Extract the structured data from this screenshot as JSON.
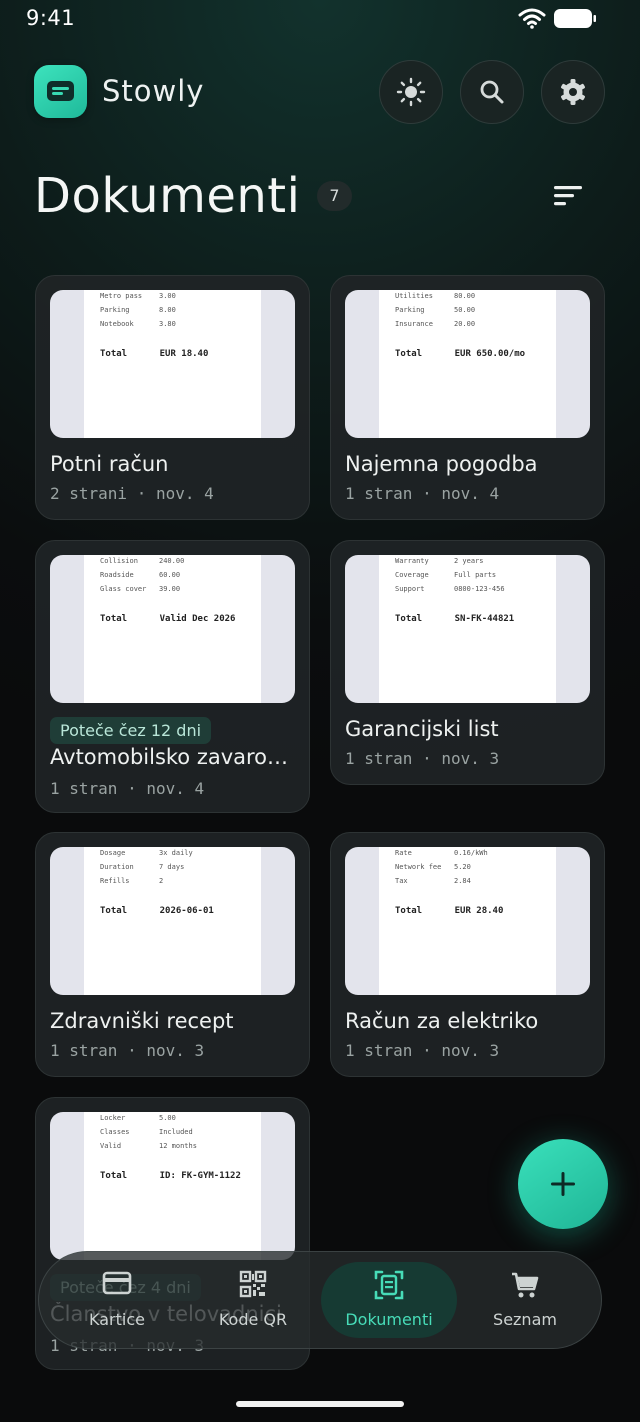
{
  "status": {
    "time": "9:41"
  },
  "app": {
    "title": "Stowly"
  },
  "header": {
    "title": "Dokumenti",
    "count": "7"
  },
  "documents": [
    {
      "title": "Potni račun",
      "meta": "2 strani · nov. 4",
      "expiry": "",
      "receipt": [
        [
          "Metro pass",
          "3.00"
        ],
        [
          "Parking",
          "8.00"
        ],
        [
          "Notebook",
          "3.80"
        ]
      ],
      "total": [
        "Total",
        "EUR 18.40"
      ]
    },
    {
      "title": "Najemna pogodba",
      "meta": "1 stran · nov. 4",
      "expiry": "",
      "receipt": [
        [
          "Utilities",
          "80.00"
        ],
        [
          "Parking",
          "50.00"
        ],
        [
          "Insurance",
          "20.00"
        ]
      ],
      "total": [
        "Total",
        "EUR 650.00/mo"
      ]
    },
    {
      "title": "Avtomobilsko zavarovanje",
      "meta": "1 stran · nov. 4",
      "expiry": "Poteče čez 12 dni",
      "receipt": [
        [
          "Collision",
          "240.00"
        ],
        [
          "Roadside",
          "60.00"
        ],
        [
          "Glass cover",
          "39.00"
        ]
      ],
      "total": [
        "Total",
        "Valid Dec 2026"
      ]
    },
    {
      "title": "Garancijski list",
      "meta": "1 stran · nov. 3",
      "expiry": "",
      "receipt": [
        [
          "Warranty",
          "2 years"
        ],
        [
          "Coverage",
          "Full parts"
        ],
        [
          "Support",
          "0800-123-456"
        ]
      ],
      "total": [
        "Total",
        "SN-FK-44821"
      ]
    },
    {
      "title": "Zdravniški recept",
      "meta": "1 stran · nov. 3",
      "expiry": "",
      "receipt": [
        [
          "Dosage",
          "3x daily"
        ],
        [
          "Duration",
          "7 days"
        ],
        [
          "Refills",
          "2"
        ]
      ],
      "total": [
        "Total",
        "2026-06-01"
      ]
    },
    {
      "title": "Račun za elektriko",
      "meta": "1 stran · nov. 3",
      "expiry": "",
      "receipt": [
        [
          "Rate",
          "0.16/kWh"
        ],
        [
          "Network fee",
          "5.20"
        ],
        [
          "Tax",
          "2.84"
        ]
      ],
      "total": [
        "Total",
        "EUR 28.40"
      ]
    },
    {
      "title": "Članstvo v telovadnici",
      "meta": "1 stran · nov. 3",
      "expiry": "Poteče čez 4 dni",
      "receipt": [
        [
          "Locker",
          "5.00"
        ],
        [
          "Classes",
          "Included"
        ],
        [
          "Valid",
          "12 months"
        ]
      ],
      "total": [
        "Total",
        "ID: FK-GYM-1122"
      ]
    }
  ],
  "nav": [
    {
      "label": "Kartice",
      "icon": "credit-card-icon",
      "active": false
    },
    {
      "label": "Kode QR",
      "icon": "qr-code-icon",
      "active": false
    },
    {
      "label": "Dokumenti",
      "icon": "document-scan-icon",
      "active": true
    },
    {
      "label": "Seznam",
      "icon": "shopping-cart-icon",
      "active": false
    }
  ],
  "colors": {
    "accent": "#3ad9b6",
    "background": "#0b0d0e",
    "card": "#202426"
  }
}
